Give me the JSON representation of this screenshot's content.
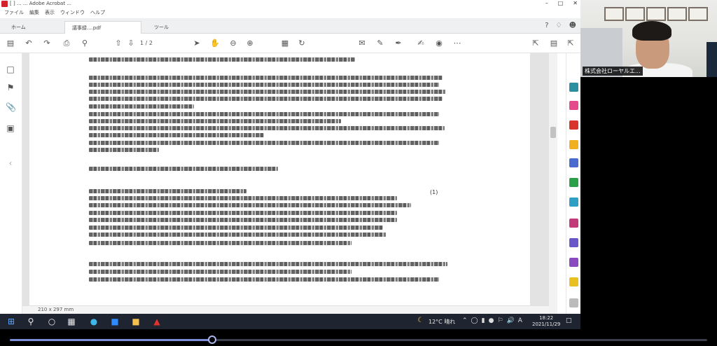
{
  "window": {
    "title": "[ ] ... ... Adobe Acrobat ...",
    "controls": [
      "–",
      "□",
      "✕"
    ]
  },
  "menubar": [
    "ファイル",
    "編集",
    "表示",
    "ウィンドウ",
    "ヘルプ"
  ],
  "tabs": [
    {
      "label": "ホーム",
      "active": false
    },
    {
      "label": "議事録....pdf",
      "active": true
    },
    {
      "label": "ツール",
      "active": false
    }
  ],
  "toolbar": {
    "page_indicator": "1 / 2",
    "icons": [
      "sidebar-icon",
      "back-icon",
      "forward-icon",
      "print-icon",
      "search-icon",
      "prev-page-icon",
      "next-page-icon",
      "select-icon",
      "hand-icon",
      "zoom-out-icon",
      "zoom-in-icon",
      "fit-icon",
      "rotate-icon",
      "comment-icon",
      "pen-icon",
      "highlight-icon",
      "sign-icon",
      "share-icon",
      "save-icon"
    ]
  },
  "document": {
    "page_marker": "(1)",
    "page_size": "210 x 297 mm"
  },
  "taskbar": {
    "weather_temp": "12°C",
    "weather_text": "晴れ",
    "input_mode": "A",
    "time": "18:22",
    "date": "2021/11/29"
  },
  "participant": {
    "name": "株式会社ローヤルエ..."
  },
  "playback": {
    "progress": 0.29
  }
}
